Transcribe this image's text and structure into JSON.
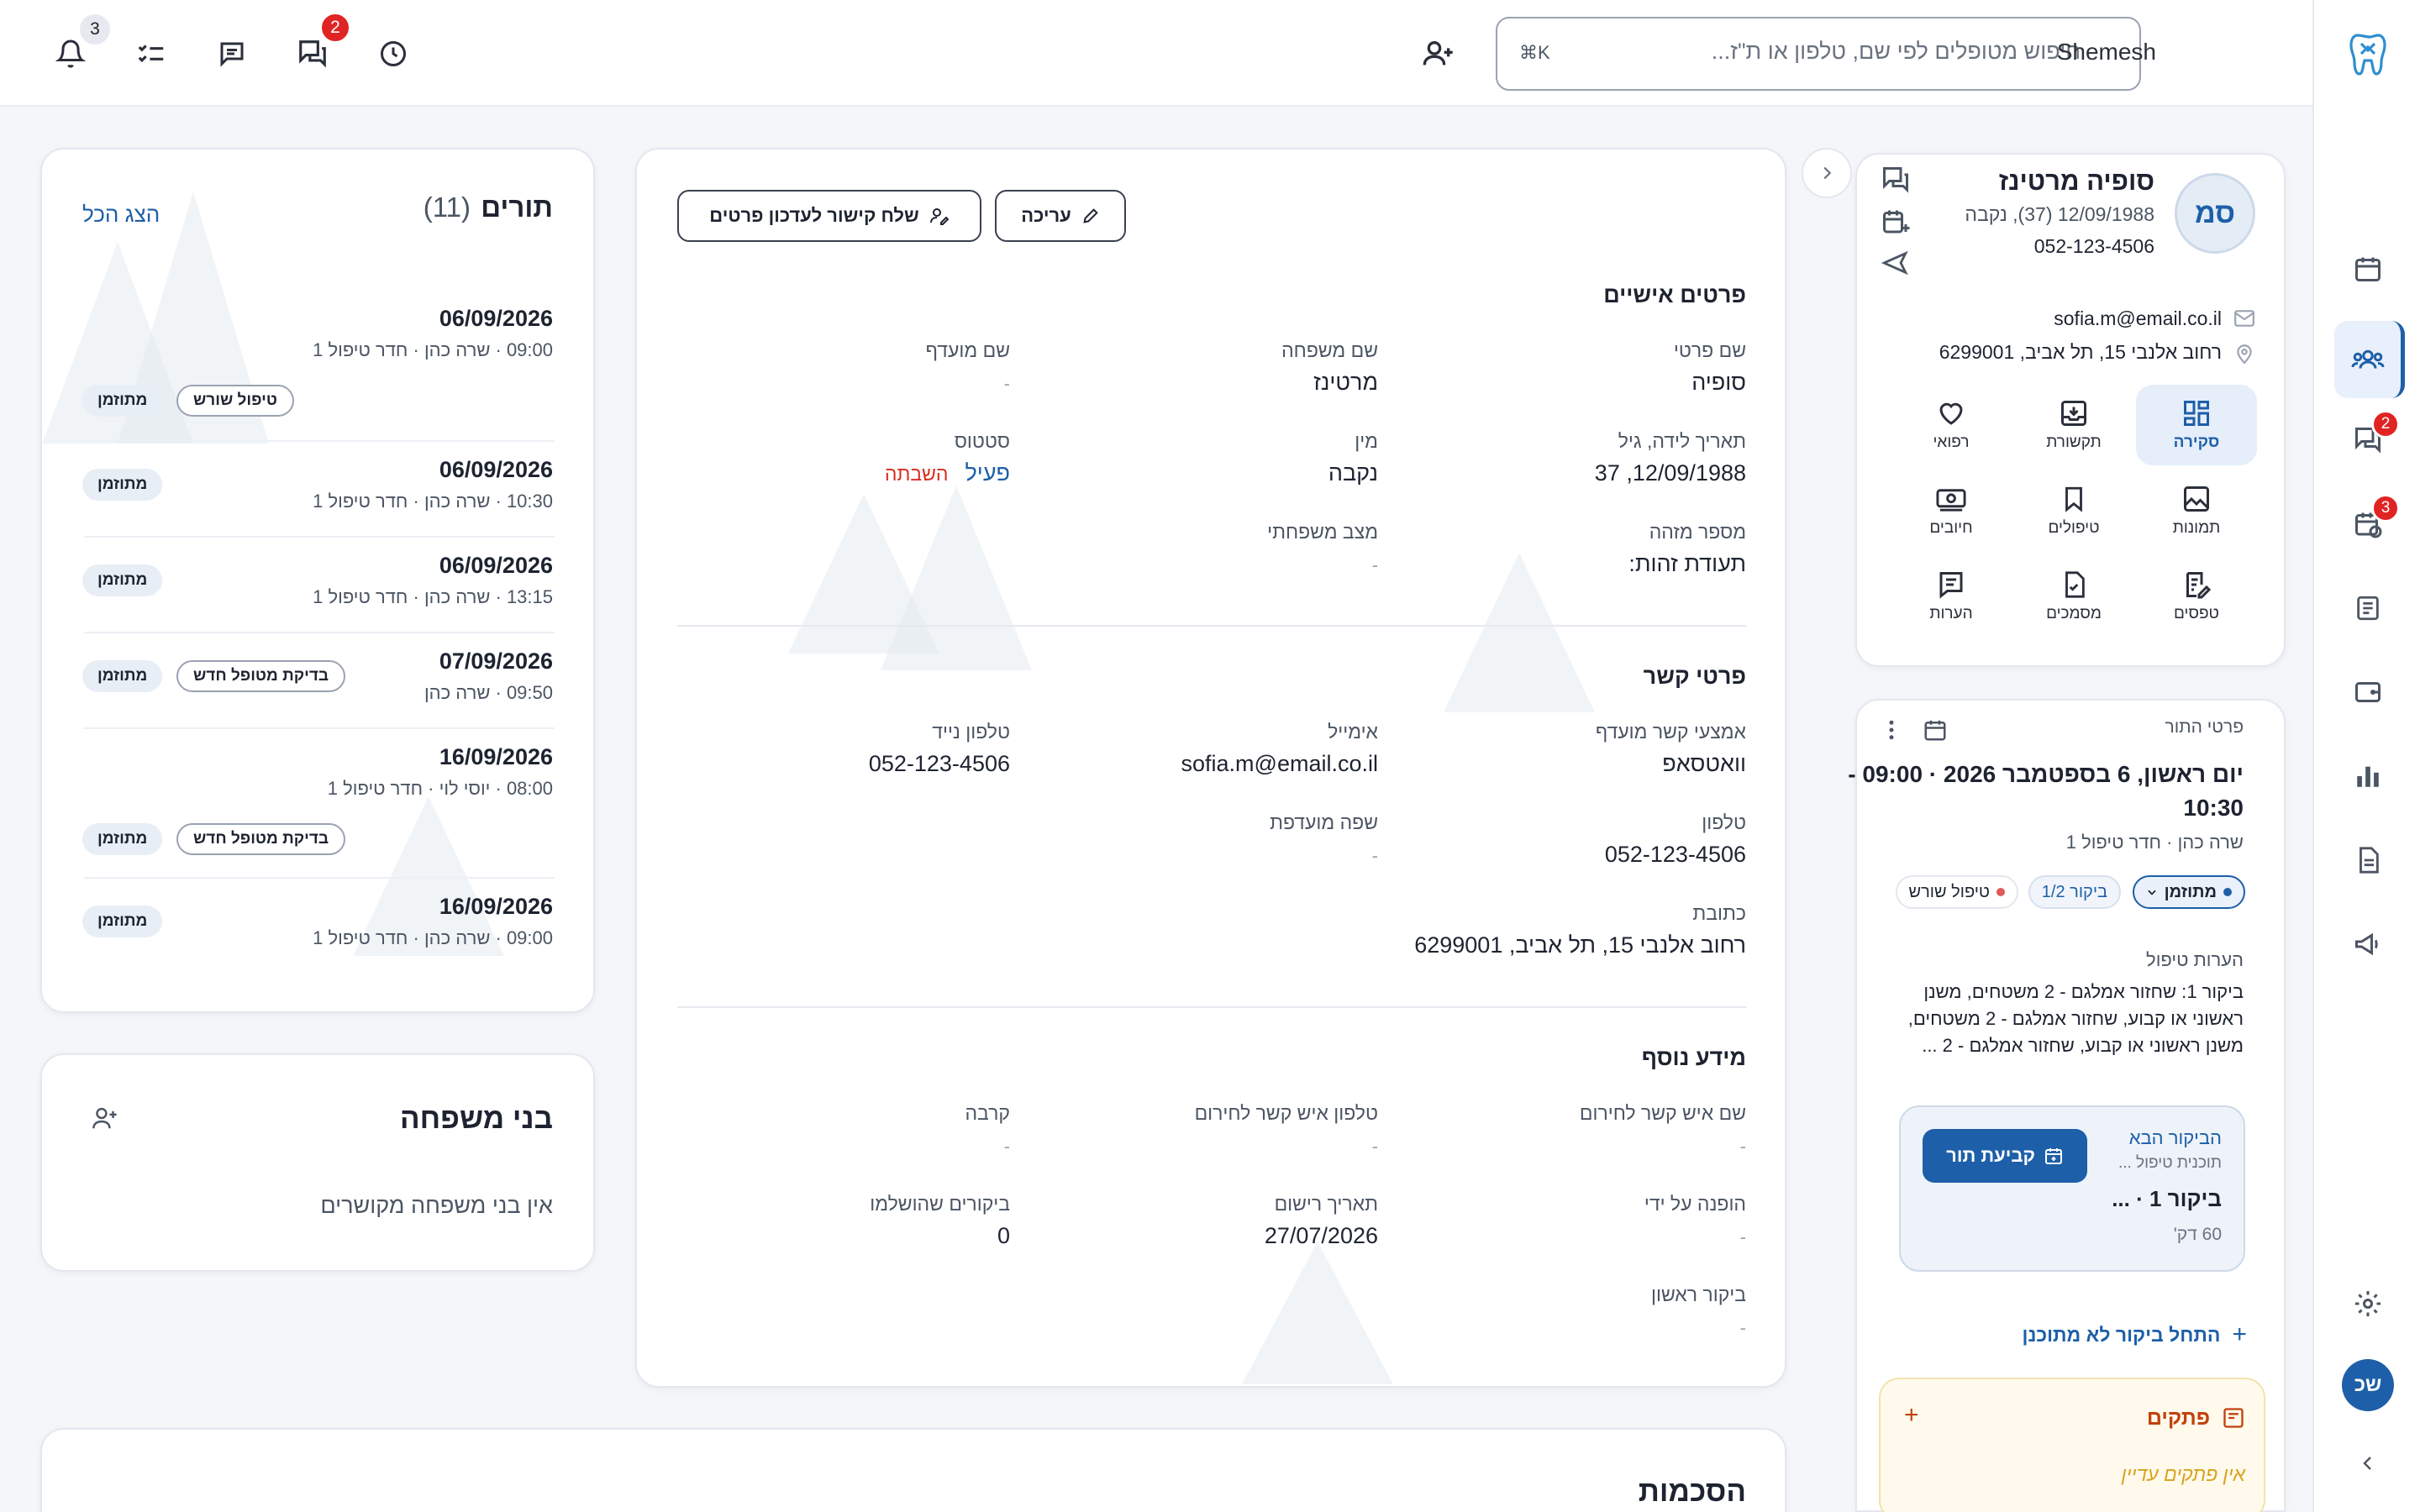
{
  "topbar": {
    "notifications_count": "3",
    "chat_count": "2",
    "search_placeholder": "חיפוש מטופלים לפי שם, טלפון או ת\"ז...",
    "search_shortcut": "⌘K",
    "brand": "Shemesh"
  },
  "rail": {
    "chat_badge": "2",
    "recalls_badge": "3",
    "avatar_initials": "שכ"
  },
  "patient": {
    "initials": "סמ",
    "name": "סופיה מרטינז",
    "birth_line": "12/09/1988 (37), נקבה",
    "phone": "052-123-4506",
    "email": "sofia.m@email.co.il",
    "address": "רחוב אלנבי 15, תל אביב, 6299001"
  },
  "patient_nav": [
    {
      "label": "סקירה",
      "icon": "grid-icon"
    },
    {
      "label": "תקשורת",
      "icon": "inbox-icon"
    },
    {
      "label": "רפואי",
      "icon": "heart-icon"
    },
    {
      "label": "תמונות",
      "icon": "image-icon"
    },
    {
      "label": "טיפולים",
      "icon": "bookmark-icon"
    },
    {
      "label": "חיובים",
      "icon": "money-icon"
    },
    {
      "label": "טפסים",
      "icon": "form-icon"
    },
    {
      "label": "מסמכים",
      "icon": "document-check-icon"
    },
    {
      "label": "הערות",
      "icon": "note-icon"
    }
  ],
  "appointment": {
    "header": "פרטי התור",
    "title": "יום ראשון, 6 בספטמבר 2026 · 09:00 - 10:30",
    "title_line1": "יום ראשון, 6 בספטמבר 2026 · 09:00 -",
    "title_line2": "10:30",
    "provider": "שרה כהן · חדר טיפול 1",
    "status_pill": "מתוזמן",
    "visit_pill": "ביקור 1/2",
    "type_pill": "טיפול שורש",
    "notes_label": "הערות טיפול",
    "notes_line1": "ביקור 1: שחזור אמלגם - 2 משטחים, משנן",
    "notes_line2": "ראשוני או קבוע, שחזור אמלגם - 2 משטחים,",
    "notes_line3": "משנן ראשוני או קבוע, שחזור אמלגם - 2 ...",
    "next_visit_label": "הביקור הבא",
    "next_visit_plan": "תוכנית טיפול ...",
    "next_visit_title": "ביקור 1 · ...",
    "next_visit_duration": "60 דק'",
    "book_button": "קביעת תור",
    "start_unplanned": "התחל ביקור לא מתוכנן",
    "tickets_title": "פתקים",
    "tickets_empty": "אין פתקים עדיין"
  },
  "main": {
    "send_link_button": "שלח קישור לעדכון פרטים",
    "edit_button": "עריכה",
    "personal": {
      "title": "פרטים אישיים",
      "first_name_label": "שם פרטי",
      "first_name": "סופיה",
      "last_name_label": "שם משפחה",
      "last_name": "מרטינז",
      "preferred_name_label": "שם מועדף",
      "preferred_name": "-",
      "dob_label": "תאריך לידה, גיל",
      "dob": "12/09/1988, 37",
      "gender_label": "מין",
      "gender": "נקבה",
      "status_label": "סטטוס",
      "status_active": "פעיל",
      "status_suspend": "השבתה",
      "id_label": "מספר מזהה",
      "id_value": "תעודת זהות:",
      "marital_label": "מצב משפחתי",
      "marital": "-"
    },
    "contact": {
      "title": "פרטי קשר",
      "preferred_contact_label": "אמצעי קשר מועדף",
      "preferred_contact": "וואטסאפ",
      "email_label": "אימייל",
      "email": "sofia.m@email.co.il",
      "mobile_label": "טלפון נייד",
      "mobile": "052-123-4506",
      "phone_label": "טלפון",
      "phone": "052-123-4506",
      "language_label": "שפה מועדפת",
      "language": "-",
      "address_label": "כתובת",
      "address": "רחוב אלנבי 15, תל אביב, 6299001"
    },
    "extra": {
      "title": "מידע נוסף",
      "emergency_name_label": "שם איש קשר לחירום",
      "emergency_name": "-",
      "emergency_phone_label": "טלפון איש קשר לחירום",
      "emergency_phone": "-",
      "relation_label": "קרבה",
      "relation": "-",
      "referred_label": "הופנה על ידי",
      "referred": "-",
      "registered_label": "תאריך רישום",
      "registered": "27/07/2026",
      "completed_label": "ביקורים שהושלמו",
      "completed": "0",
      "first_visit_label": "ביקור ראשון",
      "first_visit": "-"
    }
  },
  "appointments_list": {
    "title": "תורים",
    "count": "(11)",
    "show_all": "הצג הכל",
    "items": [
      {
        "date": "06/09/2026",
        "sub": "09:00 · שרה כהן · חדר טיפול 1",
        "status": "מתוזמן",
        "type": "טיפול שורש"
      },
      {
        "date": "06/09/2026",
        "sub": "10:30 · שרה כהן · חדר טיפול 1",
        "status": "מתוזמן",
        "type": ""
      },
      {
        "date": "06/09/2026",
        "sub": "13:15 · שרה כהן · חדר טיפול 1",
        "status": "מתוזמן",
        "type": ""
      },
      {
        "date": "07/09/2026",
        "sub": "09:50 · שרה כהן",
        "status": "מתוזמן",
        "type": "בדיקת מטופל חדש"
      },
      {
        "date": "16/09/2026",
        "sub": "08:00 · יוסי לוי · חדר טיפול 1",
        "status": "מתוזמן",
        "type": "בדיקת מטופל חדש"
      },
      {
        "date": "16/09/2026",
        "sub": "09:00 · שרה כהן · חדר טיפול 1",
        "status": "מתוזמן",
        "type": ""
      }
    ]
  },
  "family": {
    "title": "בני משפחה",
    "empty": "אין בני משפחה מקושרים"
  },
  "consents": {
    "title": "הסכמות"
  },
  "colors": {
    "primary": "#1d5fa8",
    "badge": "#e02424",
    "active_status": "#1d5fa8",
    "suspend_status": "#d92d20",
    "tickets_accent": "#c2410c"
  }
}
